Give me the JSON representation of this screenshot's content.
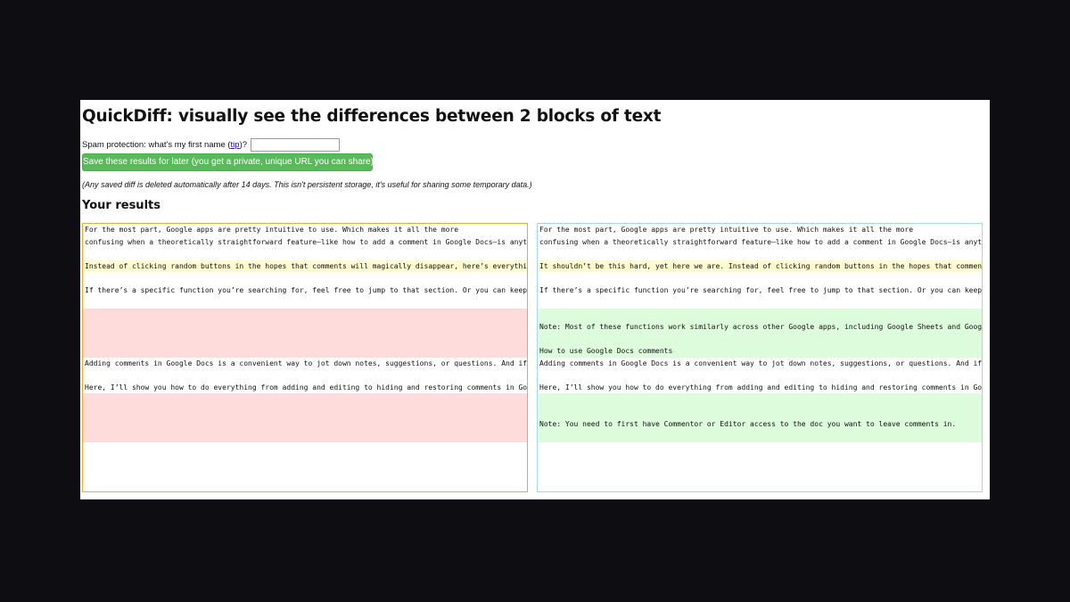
{
  "header": {
    "title": "QuickDiff: visually see the differences between 2 blocks of text"
  },
  "spam": {
    "prefix": "Spam protection: what's my first name (",
    "tip_link": "tip",
    "suffix": ")?",
    "input_value": ""
  },
  "save_button": {
    "label": "Save these results for later (you get a private, unique URL you can share)"
  },
  "note": "(Any saved diff is deleted automatically after 14 days. This isn't persistent storage, it's useful for sharing some temporary data.)",
  "results_heading": "Your results",
  "left_lines": [
    {
      "text": "For the most part, Google apps are pretty intuitive to use. Which makes it all the more",
      "status": "same"
    },
    {
      "text": "confusing when a theoretically straightforward feature—like how to add a comment in Google Docs—is anything but.",
      "status": "same"
    },
    {
      "text": "",
      "status": "same"
    },
    {
      "text": "Instead of clicking random buttons in the hopes that comments will magically disappear, here’s everything you need to know.",
      "status": "changed"
    },
    {
      "text": "",
      "status": "same"
    },
    {
      "text": "If there’s a specific function you’re searching for, feel free to jump to that section. Or you can keep scrolling.",
      "status": "same"
    },
    {
      "text": "",
      "status": "same"
    },
    {
      "text": "",
      "status": "removed"
    },
    {
      "text": "",
      "status": "removed"
    },
    {
      "text": "",
      "status": "removed"
    },
    {
      "text": "",
      "status": "removed"
    },
    {
      "text": "Adding comments in Google Docs is a convenient way to jot down notes, suggestions, or questions. And if you’re",
      "status": "same"
    },
    {
      "text": "",
      "status": "same"
    },
    {
      "text": "Here, I’ll show you how to do everything from adding and editing to hiding and restoring comments in Google Docs.",
      "status": "same"
    },
    {
      "text": "",
      "status": "removed"
    },
    {
      "text": "",
      "status": "removed"
    },
    {
      "text": "",
      "status": "removed"
    },
    {
      "text": "",
      "status": "removed"
    }
  ],
  "right_lines": [
    {
      "text": "For the most part, Google apps are pretty intuitive to use. Which makes it all the more",
      "status": "same"
    },
    {
      "text": "confusing when a theoretically straightforward feature—like how to add a comment in Google Docs—is anything but.",
      "status": "same"
    },
    {
      "text": "",
      "status": "same"
    },
    {
      "text": "It shouldn’t be this hard, yet here we are. Instead of clicking random buttons in the hopes that comments will magically disappear.",
      "status": "changed"
    },
    {
      "text": "",
      "status": "same"
    },
    {
      "text": "If there’s a specific function you’re searching for, feel free to jump to that section. Or you can keep scrolling.",
      "status": "same"
    },
    {
      "text": "",
      "status": "same"
    },
    {
      "text": "",
      "status": "added"
    },
    {
      "text": "Note: Most of these functions work similarly across other Google apps, including Google Sheets and Google Slides.",
      "status": "added"
    },
    {
      "text": "",
      "status": "added"
    },
    {
      "text": "How to use Google Docs comments",
      "status": "added"
    },
    {
      "text": "Adding comments in Google Docs is a convenient way to jot down notes, suggestions, or questions. And if you’re",
      "status": "same"
    },
    {
      "text": "",
      "status": "same"
    },
    {
      "text": "Here, I’ll show you how to do everything from adding and editing to hiding and restoring comments in Google Docs.",
      "status": "same"
    },
    {
      "text": "",
      "status": "added"
    },
    {
      "text": "",
      "status": "added"
    },
    {
      "text": "Note: You need to first have Commentor or Editor access to the doc you want to leave comments in.",
      "status": "added"
    },
    {
      "text": "",
      "status": "added"
    }
  ]
}
